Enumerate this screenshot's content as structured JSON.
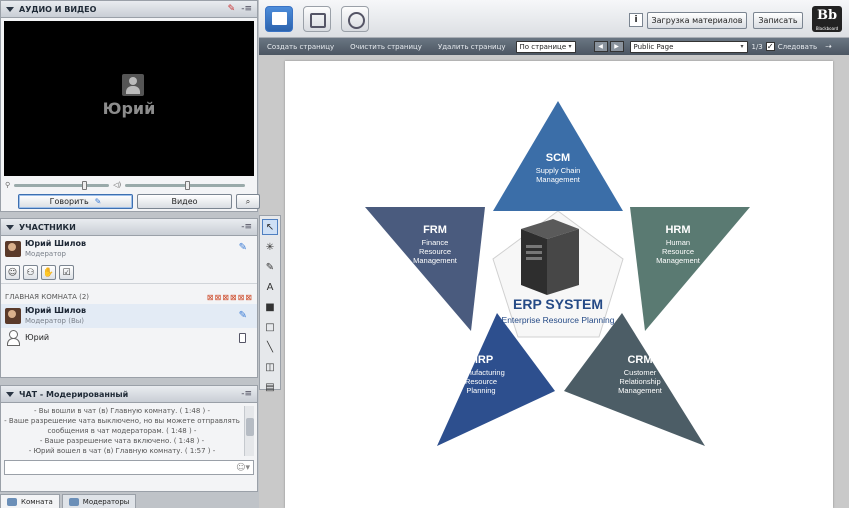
{
  "audio_video": {
    "title": "АУДИО И ВИДЕО",
    "user_name": "Юрий",
    "talk_label": "Говорить",
    "video_label": "Видео",
    "menu": "-≡"
  },
  "participants": {
    "title": "УЧАСТНИКИ",
    "menu": "-≡",
    "me": {
      "name": "Юрий Шилов",
      "role": "Модератор"
    },
    "room_title": "ГЛАВНАЯ КОМНАТА (2)",
    "members": [
      {
        "name": "Юрий Шилов",
        "role": "Модератор (Вы)"
      },
      {
        "name": "Юрий",
        "role": ""
      }
    ]
  },
  "chat": {
    "title": "ЧАТ - Модерированный",
    "menu": "-≡",
    "messages": [
      "- Вы вошли в чат (в) Главную комнату. ( 1:48 ) -",
      "- Ваше разрешение чата выключено, но вы можете отправлять сообщения в чат модераторам. ( 1:48 ) -",
      "- Ваше разрешение чата включено. ( 1:48 ) -",
      "- Юрий вошел в чат (в) Главную комнату. ( 1:57 ) -"
    ],
    "tabs": [
      "Комната",
      "Модераторы"
    ]
  },
  "topbar": {
    "load_label": "Загрузка материалов",
    "record_label": "Записать",
    "info": "i",
    "logo": "Bb",
    "logo_sub": "Blackboard"
  },
  "whiteboard": {
    "create": "Создать страницу",
    "clear": "Очистить страницу",
    "delete": "Удалить страницу",
    "fit": "По странице",
    "page_select": "Public Page",
    "page_count": "1/3",
    "follow": "Следовать"
  },
  "slide": {
    "center_title": "ERP SYSTEM",
    "center_sub": "Enterprise Resource Planning",
    "points": [
      {
        "abbr": "SCM",
        "lines": [
          "Supply Chain",
          "Management"
        ],
        "color": "#3b6ea8"
      },
      {
        "abbr": "HRM",
        "lines": [
          "Human",
          "Resource",
          "Management"
        ],
        "color": "#5a7a72"
      },
      {
        "abbr": "CRM",
        "lines": [
          "Customer",
          "Relationship",
          "Management"
        ],
        "color": "#4c5d66"
      },
      {
        "abbr": "MRP",
        "lines": [
          "Manufacturing",
          "Resource",
          "Planning"
        ],
        "color": "#2d4f8e"
      },
      {
        "abbr": "FRM",
        "lines": [
          "Finance",
          "Resource",
          "Management"
        ],
        "color": "#4a5b7e"
      }
    ]
  }
}
